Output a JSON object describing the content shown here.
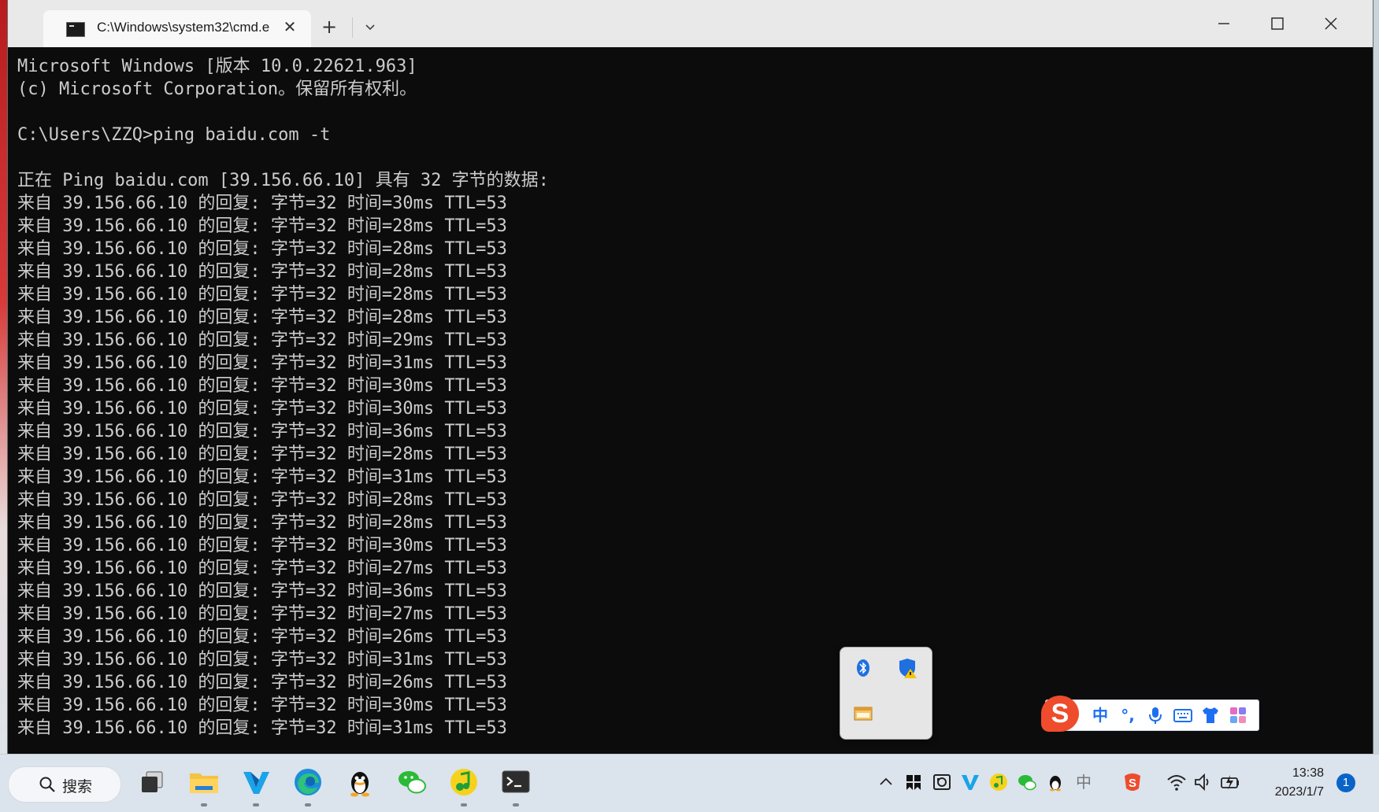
{
  "window": {
    "tab_title": "C:\\Windows\\system32\\cmd.e",
    "new_tab_symbol": "+",
    "close_tab_symbol": "✕"
  },
  "console": {
    "lines": [
      "Microsoft Windows [版本 10.0.22621.963]",
      "(c) Microsoft Corporation。保留所有权利。",
      "",
      "C:\\Users\\ZZQ>ping baidu.com -t",
      "",
      "正在 Ping baidu.com [39.156.66.10] 具有 32 字节的数据:",
      "来自 39.156.66.10 的回复: 字节=32 时间=30ms TTL=53",
      "来自 39.156.66.10 的回复: 字节=32 时间=28ms TTL=53",
      "来自 39.156.66.10 的回复: 字节=32 时间=28ms TTL=53",
      "来自 39.156.66.10 的回复: 字节=32 时间=28ms TTL=53",
      "来自 39.156.66.10 的回复: 字节=32 时间=28ms TTL=53",
      "来自 39.156.66.10 的回复: 字节=32 时间=28ms TTL=53",
      "来自 39.156.66.10 的回复: 字节=32 时间=29ms TTL=53",
      "来自 39.156.66.10 的回复: 字节=32 时间=31ms TTL=53",
      "来自 39.156.66.10 的回复: 字节=32 时间=30ms TTL=53",
      "来自 39.156.66.10 的回复: 字节=32 时间=30ms TTL=53",
      "来自 39.156.66.10 的回复: 字节=32 时间=36ms TTL=53",
      "来自 39.156.66.10 的回复: 字节=32 时间=28ms TTL=53",
      "来自 39.156.66.10 的回复: 字节=32 时间=31ms TTL=53",
      "来自 39.156.66.10 的回复: 字节=32 时间=28ms TTL=53",
      "来自 39.156.66.10 的回复: 字节=32 时间=28ms TTL=53",
      "来自 39.156.66.10 的回复: 字节=32 时间=30ms TTL=53",
      "来自 39.156.66.10 的回复: 字节=32 时间=27ms TTL=53",
      "来自 39.156.66.10 的回复: 字节=32 时间=36ms TTL=53",
      "来自 39.156.66.10 的回复: 字节=32 时间=27ms TTL=53",
      "来自 39.156.66.10 的回复: 字节=32 时间=26ms TTL=53",
      "来自 39.156.66.10 的回复: 字节=32 时间=31ms TTL=53",
      "来自 39.156.66.10 的回复: 字节=32 时间=26ms TTL=53",
      "来自 39.156.66.10 的回复: 字节=32 时间=30ms TTL=53",
      "来自 39.156.66.10 的回复: 字节=32 时间=31ms TTL=53"
    ]
  },
  "ime": {
    "logo": "S",
    "mode": "中",
    "punct": "°,"
  },
  "taskbar": {
    "search_label": "搜索",
    "tray_lang": "中",
    "time": "13:38",
    "date": "2023/1/7",
    "notification_count": "1"
  },
  "colors": {
    "console_bg": "#0c0c0c",
    "console_fg": "#cccccc",
    "accent": "#0a64c8"
  }
}
